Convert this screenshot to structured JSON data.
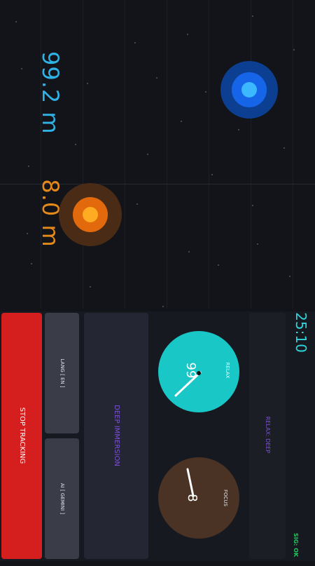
{
  "map": {
    "blue_target": {
      "distance": "99.2 m",
      "color": "#2fb2e6"
    },
    "orange_target": {
      "distance": "8.0 m",
      "color": "#e58a1a"
    }
  },
  "controls": {
    "stop_label": "STOP TRACKING",
    "lang_label": "LANG [ EN ]",
    "ai_label": "AI [ GEMINI ]",
    "immersion_label": "DEEP IMMERSION",
    "relax_gauge": {
      "label": "RELAX",
      "value": "99",
      "color": "#19c7c7"
    },
    "focus_gauge": {
      "label": "FOCUS",
      "value": "8",
      "color": "#4a3224"
    },
    "mode_label": "RELAX: DEEP",
    "timer": "25:10",
    "signal": "SIG: OK"
  },
  "colors": {
    "stop_button": "#d51f1f",
    "accent_purple": "#7b4fd6",
    "signal_green": "#22c55e",
    "timer_cyan": "#2fd6dd"
  }
}
